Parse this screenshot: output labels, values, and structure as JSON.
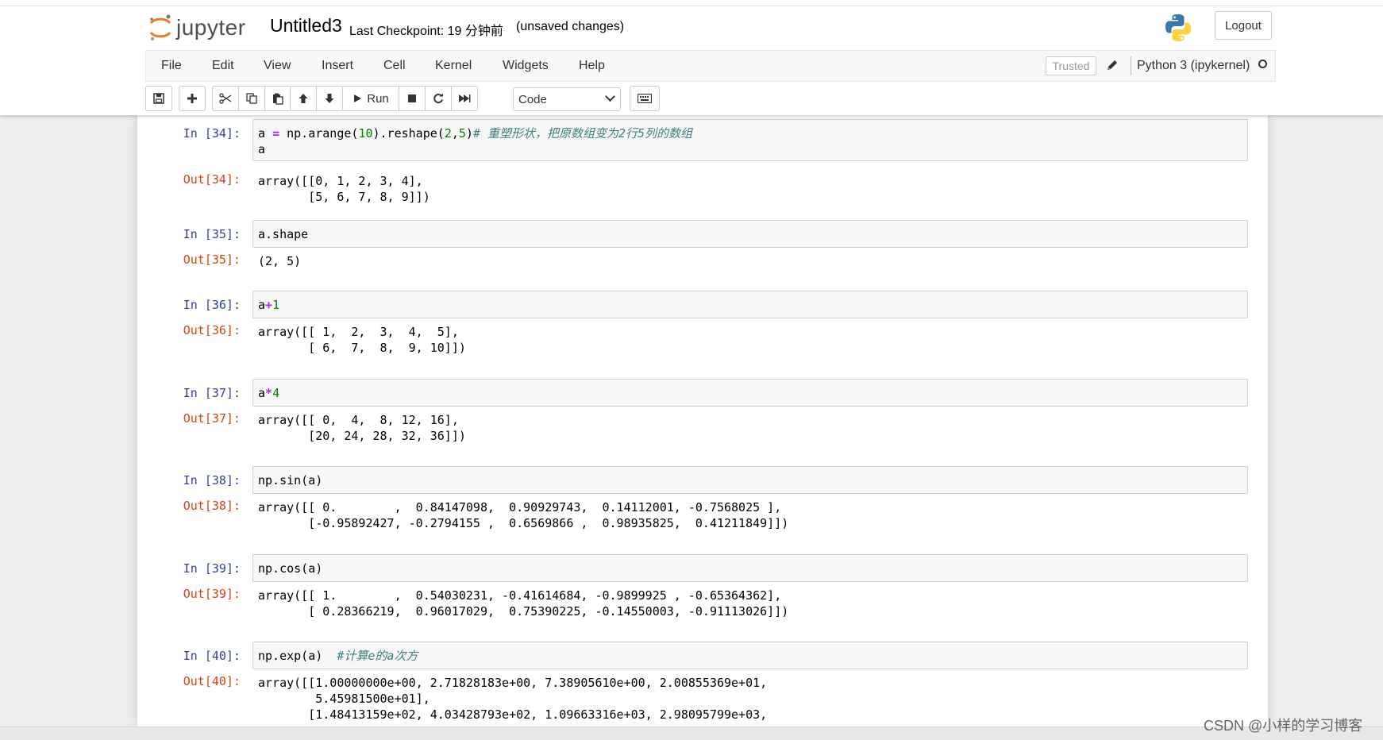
{
  "header": {
    "logo_text": "jupyter",
    "notebook_title": "Untitled3",
    "checkpoint": "Last Checkpoint: 19 分钟前",
    "unsaved": "(unsaved changes)",
    "logout_label": "Logout"
  },
  "menubar": {
    "items": [
      "File",
      "Edit",
      "View",
      "Insert",
      "Cell",
      "Kernel",
      "Widgets",
      "Help"
    ],
    "trusted_label": "Trusted",
    "kernel_name": "Python 3 (ipykernel)"
  },
  "toolbar": {
    "run_label": "Run",
    "cell_type": "Code",
    "icons": [
      "save-icon",
      "plus-icon",
      "scissors-icon",
      "copy-icon",
      "paste-icon",
      "arrow-up-icon",
      "arrow-down-icon",
      "play-icon",
      "stop-icon",
      "restart-icon",
      "fast-forward-icon",
      "keyboard-icon"
    ]
  },
  "cells": [
    {
      "in_prompt": "In  [34]:",
      "input_lines": [
        "a = np.arange(10).reshape(2,5)# 重塑形状, 把原数组变为2行5列的数组",
        "a"
      ],
      "out_prompt": "Out[34]:",
      "output_lines": [
        "array([[0, 1, 2, 3, 4],",
        "       [5, 6, 7, 8, 9]])"
      ]
    },
    {
      "in_prompt": "In  [35]:",
      "input_lines": [
        "a.shape"
      ],
      "out_prompt": "Out[35]:",
      "output_lines": [
        "(2, 5)"
      ]
    },
    {
      "in_prompt": "In  [36]:",
      "input_lines": [
        "a+1"
      ],
      "out_prompt": "Out[36]:",
      "output_lines": [
        "array([[ 1,  2,  3,  4,  5],",
        "       [ 6,  7,  8,  9, 10]])"
      ]
    },
    {
      "in_prompt": "In  [37]:",
      "input_lines": [
        "a*4"
      ],
      "out_prompt": "Out[37]:",
      "output_lines": [
        "array([[ 0,  4,  8, 12, 16],",
        "       [20, 24, 28, 32, 36]])"
      ]
    },
    {
      "in_prompt": "In  [38]:",
      "input_lines": [
        "np.sin(a)"
      ],
      "out_prompt": "Out[38]:",
      "output_lines": [
        "array([[ 0.        ,  0.84147098,  0.90929743,  0.14112001, -0.7568025 ],",
        "       [-0.95892427, -0.2794155 ,  0.6569866 ,  0.98935825,  0.41211849]])"
      ]
    },
    {
      "in_prompt": "In  [39]:",
      "input_lines": [
        "np.cos(a)"
      ],
      "out_prompt": "Out[39]:",
      "output_lines": [
        "array([[ 1.        ,  0.54030231, -0.41614684, -0.9899925 , -0.65364362],",
        "       [ 0.28366219,  0.96017029,  0.75390225, -0.14550003, -0.91113026]])"
      ]
    },
    {
      "in_prompt": "In  [40]:",
      "input_lines": [
        "np.exp(a)  #计算e的a次方"
      ],
      "out_prompt": "Out[40]:",
      "output_lines": [
        "array([[1.00000000e+00, 2.71828183e+00, 7.38905610e+00, 2.00855369e+01,",
        "        5.45981500e+01],",
        "       [1.48413159e+02, 4.03428793e+02, 1.09663316e+03, 2.98095799e+03,"
      ]
    }
  ],
  "watermark": "CSDN @小样的学习博客",
  "colors": {
    "in_prompt": "#303f9f",
    "out_prompt": "#d84315",
    "comment": "#408080",
    "number": "#008000",
    "operator": "#aa22ff"
  }
}
